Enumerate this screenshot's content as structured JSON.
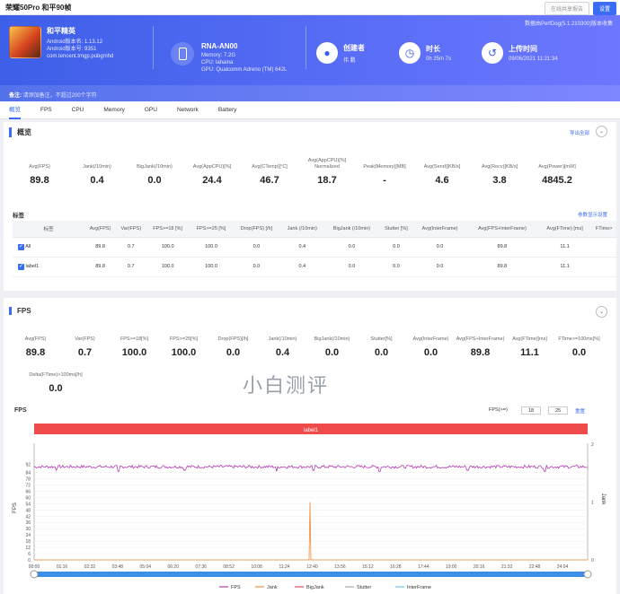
{
  "topbar": {
    "title": "荣耀50Pro 和平90帧",
    "btn_disabled": "在线共享报告",
    "btn_settings": "设置"
  },
  "hero": {
    "note": "数据由PerfDog(5.1.210300)版本收集",
    "game": {
      "name": "和平精英",
      "android_version": "Android版本名: 1.13.12",
      "android_code": "Android版本号: 9351",
      "package": "com.tencent.tmgp.pubgmhd"
    },
    "device": {
      "model": "RNA-AN00",
      "memory": "Memory: 7.2G",
      "cpu": "CPU: lahaina",
      "gpu": "GPU: Qualcomm Adreno (TM) 642L"
    },
    "creator": {
      "label": "创建者",
      "value": "伟 鹏"
    },
    "duration": {
      "label": "时长",
      "value": "0h 25m 7s"
    },
    "upload": {
      "label": "上传时间",
      "value": "09/06/2021 11:21:34"
    },
    "remark_label": "备注:",
    "remark_placeholder": "请添加备注，不超过200个字符"
  },
  "tabs": [
    "概览",
    "FPS",
    "CPU",
    "Memory",
    "GPU",
    "Network",
    "Battery"
  ],
  "overview": {
    "title": "概览",
    "export": "导出全部",
    "metrics": [
      {
        "label": "Avg(FPS)",
        "value": "89.8"
      },
      {
        "label": "Jank(/10min)",
        "value": "0.4"
      },
      {
        "label": "BigJank(/10min)",
        "value": "0.0"
      },
      {
        "label": "Avg(AppCPU)[%]",
        "value": "24.4"
      },
      {
        "label": "Avg(CTemp)[°C]",
        "value": "46.7"
      },
      {
        "label": "Avg(AppCPU)[%] Normalized",
        "value": "18.7"
      },
      {
        "label": "Peak(Memory)[MB]",
        "value": "-"
      },
      {
        "label": "Avg(Send)[KB/s]",
        "value": "4.6"
      },
      {
        "label": "Avg(Recv)[KB/s]",
        "value": "3.8"
      },
      {
        "label": "Avg(Power)[mW]",
        "value": "4845.2"
      }
    ],
    "label_title": "标签",
    "param_link": "参数显示设置",
    "table": {
      "headers": [
        "标签",
        "Avg(FPS)",
        "Var(FPS)",
        "FPS>=18 [%]",
        "FPS>=25 [%]",
        "Drop(FPS) [/h]",
        "Jank (/10min)",
        "BigJank (/10min)",
        "Stutter [%]",
        "Avg(InterFrame)",
        "Avg(FPS+InterFrame)",
        "Avg(FTime) [ms]",
        "FTime>"
      ],
      "rows": [
        [
          "All",
          "89.8",
          "0.7",
          "100.0",
          "100.0",
          "0.0",
          "0.4",
          "0.0",
          "0.0",
          "0.0",
          "89.8",
          "11.1",
          ""
        ],
        [
          "label1",
          "89.8",
          "0.7",
          "100.0",
          "100.0",
          "0.0",
          "0.4",
          "0.0",
          "0.0",
          "0.0",
          "89.8",
          "11.1",
          ""
        ]
      ]
    }
  },
  "fps": {
    "title": "FPS",
    "metrics": [
      {
        "label": "Avg(FPS)",
        "value": "89.8"
      },
      {
        "label": "Var(FPS)",
        "value": "0.7"
      },
      {
        "label": "FPS>=18[%]",
        "value": "100.0"
      },
      {
        "label": "FPS>=25[%]",
        "value": "100.0"
      },
      {
        "label": "Drop(FPS)[/h]",
        "value": "0.0"
      },
      {
        "label": "Jank(/10min)",
        "value": "0.4"
      },
      {
        "label": "BigJank(/10min)",
        "value": "0.0"
      },
      {
        "label": "Stutter[%]",
        "value": "0.0"
      },
      {
        "label": "Avg(InterFrame)",
        "value": "0.0"
      },
      {
        "label": "Avg(FPS+InterFrame)",
        "value": "89.8"
      },
      {
        "label": "Avg(FTime)[ms]",
        "value": "11.1"
      },
      {
        "label": "FTime>=100ms[%]",
        "value": "0.0"
      }
    ],
    "delta": {
      "label": "Delta(FTime)>100ms[/h]",
      "value": "0.0"
    },
    "watermark": "小白测评",
    "chart_title": "FPS",
    "fps_ctrl_label": "FPS(>=)",
    "fps_val1": "18",
    "fps_val2": "25",
    "reset": "重置"
  },
  "chart_data": {
    "type": "line",
    "title": "FPS",
    "band_label": "label1",
    "ylabel": "FPS",
    "y2label": "Jank",
    "ylim": [
      0,
      100
    ],
    "y2lim": [
      0,
      2
    ],
    "yticks": [
      0,
      6,
      12,
      18,
      24,
      30,
      36,
      42,
      48,
      54,
      60,
      66,
      72,
      78,
      84,
      92
    ],
    "y2ticks": [
      0,
      1,
      2
    ],
    "xticks": [
      "00:00",
      "01:16",
      "02:32",
      "03:48",
      "05:04",
      "06:20",
      "07:36",
      "08:52",
      "10:08",
      "11:24",
      "12:40",
      "13:56",
      "15:12",
      "16:28",
      "17:44",
      "19:00",
      "20:16",
      "21:32",
      "22:48",
      "24:04"
    ],
    "xlim_seconds": [
      0,
      1507
    ],
    "series": [
      {
        "name": "FPS",
        "color": "#b23bb0",
        "baseline": 90,
        "spread": [
          88,
          91
        ],
        "dips": [
          [
            60,
            86
          ],
          [
            230,
            85
          ],
          [
            410,
            86
          ],
          [
            660,
            85
          ],
          [
            760,
            86
          ],
          [
            940,
            85
          ],
          [
            1180,
            86
          ],
          [
            1390,
            85
          ]
        ]
      },
      {
        "name": "Jank",
        "color": "#f08a3a",
        "spike_time": 751,
        "spike_value": 1
      },
      {
        "name": "BigJank",
        "color": "#d9534f"
      },
      {
        "name": "Stutter",
        "color": "#aaaaaa"
      },
      {
        "name": "InterFrame",
        "color": "#6fc7e8"
      }
    ],
    "grid": true,
    "legend": "bottom"
  }
}
